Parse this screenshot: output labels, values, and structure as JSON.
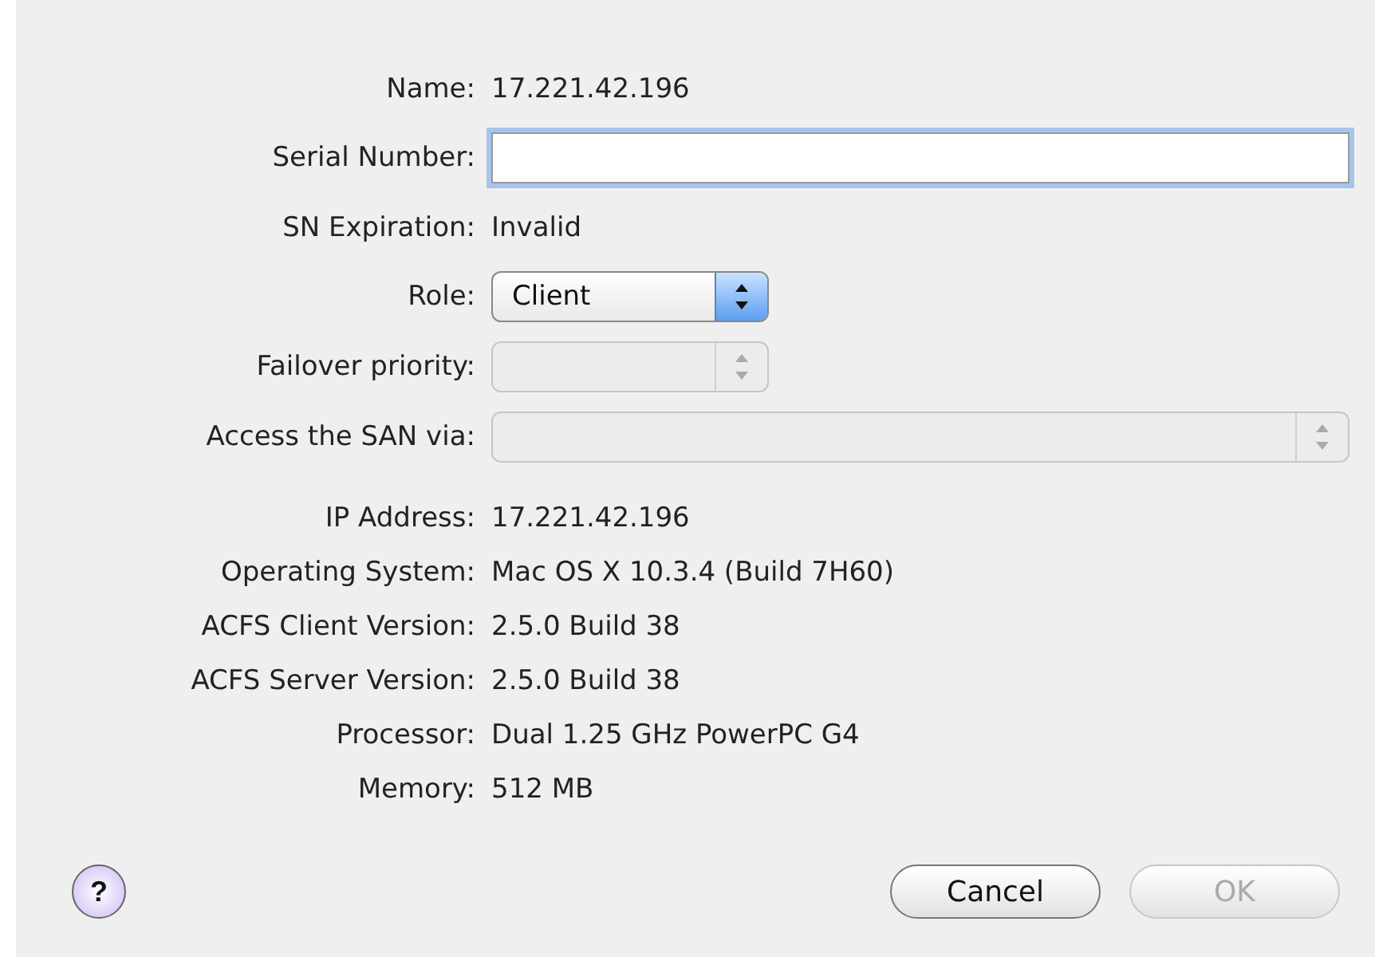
{
  "fields": [
    {
      "kind": "text",
      "label": "Name:",
      "value": "17.221.42.196"
    },
    {
      "kind": "input",
      "label": "Serial Number:",
      "focused": true
    },
    {
      "kind": "text",
      "label": "SN Expiration:",
      "value": "Invalid"
    },
    {
      "kind": "select",
      "label": "Role:",
      "value": "Client",
      "disabled": false,
      "wide": false
    },
    {
      "kind": "select",
      "label": "Failover priority:",
      "disabled": true,
      "wide": false
    },
    {
      "kind": "select",
      "label": "Access the SAN via:",
      "disabled": true,
      "wide": true
    }
  ],
  "info": [
    {
      "label": "IP Address:",
      "value": "17.221.42.196"
    },
    {
      "label": "Operating System:",
      "value": "Mac OS X 10.3.4 (Build 7H60)"
    },
    {
      "label": "ACFS Client Version:",
      "value": "2.5.0 Build 38"
    },
    {
      "label": "ACFS Server Version:",
      "value": "2.5.0 Build 38"
    },
    {
      "label": "Processor:",
      "value": "Dual 1.25 GHz PowerPC G4"
    },
    {
      "label": "Memory:",
      "value": "512 MB"
    }
  ],
  "help": "?",
  "buttons": [
    {
      "label": "Cancel",
      "disabled": false
    },
    {
      "label": "OK",
      "disabled": true
    }
  ]
}
